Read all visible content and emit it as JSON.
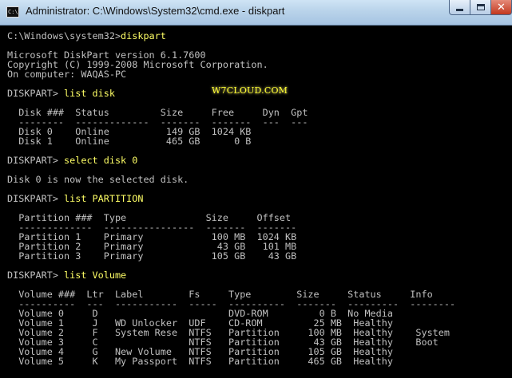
{
  "window": {
    "title": "Administrator: C:\\Windows\\System32\\cmd.exe - diskpart",
    "icon_text": "C:\\",
    "icon": "cmd-icon",
    "minimize_icon": "minimize-icon",
    "maximize_icon": "maximize-icon",
    "close_icon": "close-icon",
    "close_glyph": "✕"
  },
  "colors": {
    "console_bg": "#000000",
    "console_text": "#c0c0c0",
    "command_text": "#ffff66",
    "close_button": "#c8442a",
    "titlebar": "#b9d3ea"
  },
  "watermark": "W7CLOUD.COM",
  "session": {
    "prompt1": "C:\\Windows\\system32>",
    "cmd1": "diskpart",
    "banner": [
      "Microsoft DiskPart version 6.1.7600",
      "Copyright (C) 1999-2008 Microsoft Corporation.",
      "On computer: WAQAS-PC"
    ],
    "prompt": "DISKPART> ",
    "cmd2": "list disk",
    "disk_header": "  Disk ###  Status         Size     Free     Dyn  Gpt",
    "disk_divider": "  --------  -------------  -------  -------  ---  ---",
    "disk_rows": [
      "  Disk 0    Online          149 GB  1024 KB",
      "  Disk 1    Online          465 GB      0 B"
    ],
    "cmd3": "select disk 0",
    "select_result": "Disk 0 is now the selected disk.",
    "cmd4": "list PARTITION",
    "partition_header": "  Partition ###  Type              Size     Offset",
    "partition_divider": "  -------------  ----------------  -------  -------",
    "partition_rows": [
      "  Partition 1    Primary            100 MB  1024 KB",
      "  Partition 2    Primary             43 GB   101 MB",
      "  Partition 3    Primary            105 GB    43 GB"
    ],
    "cmd5": "list Volume",
    "volume_header": "  Volume ###  Ltr  Label        Fs     Type        Size     Status     Info",
    "volume_divider": "  ----------  ---  -----------  -----  ----------  -------  ---------  --------",
    "volume_rows": [
      "  Volume 0     D                       DVD-ROM         0 B  No Media",
      "  Volume 1     J   WD Unlocker  UDF    CD-ROM         25 MB  Healthy",
      "  Volume 2     F   System Rese  NTFS   Partition     100 MB  Healthy    System",
      "  Volume 3     C                NTFS   Partition      43 GB  Healthy    Boot",
      "  Volume 4     G   New Volume   NTFS   Partition     105 GB  Healthy",
      "  Volume 5     K   My Passport  NTFS   Partition     465 GB  Healthy"
    ]
  }
}
